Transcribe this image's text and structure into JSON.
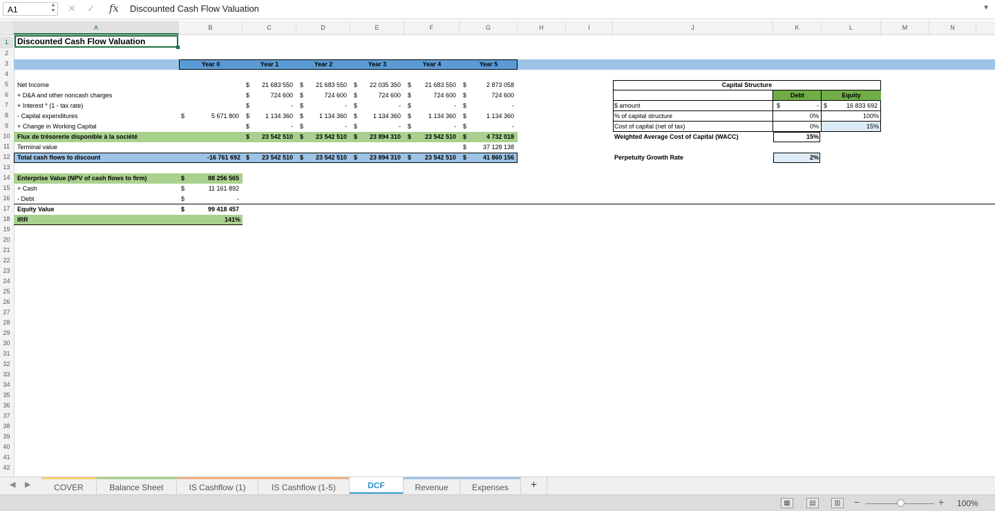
{
  "formula_bar": {
    "cell_ref": "A1",
    "content": "Discounted Cash Flow Valuation",
    "cancel_icon": "close-icon",
    "confirm_icon": "check-icon",
    "fx_label": "fx"
  },
  "columns": [
    "A",
    "B",
    "C",
    "D",
    "E",
    "F",
    "G",
    "H",
    "I",
    "J",
    "K",
    "L",
    "M",
    "N"
  ],
  "rows": [
    "1",
    "2",
    "3",
    "4",
    "5",
    "6",
    "7",
    "8",
    "9",
    "10",
    "11",
    "12",
    "13",
    "14",
    "15",
    "16",
    "17",
    "18",
    "19",
    "20",
    "21",
    "22",
    "23",
    "24",
    "25",
    "26",
    "27",
    "28",
    "29",
    "30",
    "31",
    "32",
    "33",
    "34",
    "35",
    "36",
    "37",
    "38",
    "39",
    "40",
    "41",
    "42"
  ],
  "sheet": {
    "title": "Discounted Cash Flow Valuation",
    "year_headers": [
      "Year 0",
      "Year 1",
      "Year 2",
      "Year 3",
      "Year 4",
      "Year 5"
    ],
    "currency": "$",
    "dcf_rows": [
      {
        "label": "Net Income",
        "y0": "",
        "y1": "21 683 550",
        "y2": "21 683 550",
        "y3": "22 035 350",
        "y4": "21 683 550",
        "y5": "2 873 058"
      },
      {
        "label": "+ D&A and other noncash charges",
        "y0": "",
        "y1": "724 600",
        "y2": "724 600",
        "y3": "724 600",
        "y4": "724 600",
        "y5": "724 600"
      },
      {
        "label": "+ Interest * (1 - tax rate)",
        "y0": "",
        "y1": "-",
        "y2": "-",
        "y3": "-",
        "y4": "-",
        "y5": "-"
      },
      {
        "label": "- Capital expenditures",
        "y0": "5 671 800",
        "y1": "1 134 360",
        "y2": "1 134 360",
        "y3": "1 134 360",
        "y4": "1 134 360",
        "y5": "1 134 360"
      },
      {
        "label": "+ Change in Working Capital",
        "y0": "",
        "y1": "-",
        "y2": "-",
        "y3": "-",
        "y4": "-",
        "y5": "-"
      }
    ],
    "fcf_row": {
      "label": "Flux de trésorerie disponible à la société",
      "y1": "23 542 510",
      "y2": "23 542 510",
      "y3": "23 894 310",
      "y4": "23 542 510",
      "y5": "4 732 018"
    },
    "terminal_row": {
      "label": "Terminal value",
      "y5": "37 128 138"
    },
    "total_row": {
      "label": "Total cash flows to discount",
      "y0": "-16 761 692",
      "y1": "23 542 510",
      "y2": "23 542 510",
      "y3": "23 894 310",
      "y4": "23 542 510",
      "y5": "41 860 156"
    },
    "valuation": [
      {
        "label": "Enterprise Value (NPV of cash flows to firm)",
        "value": "88 256 565"
      },
      {
        "label": "+ Cash",
        "value": "11 161 892"
      },
      {
        "label": "- Debt",
        "value": "-"
      },
      {
        "label": "Equity Value",
        "value": "99 418 457"
      }
    ],
    "irr": {
      "label": "IRR",
      "value": "141%"
    },
    "capital_structure": {
      "title": "Capital Structure",
      "debt_header": "Debt",
      "equity_header": "Equity",
      "amount_label": "$ amount",
      "amount_debt": "-",
      "amount_equity": "16 833 692",
      "pct_label": "% of capital structure",
      "pct_debt": "0%",
      "pct_equity": "100%",
      "cost_label": "Cost of capital (net of tax)",
      "cost_debt": "0%",
      "cost_equity": "15%",
      "wacc_label": "Weighted Average Cost of Capital (WACC)",
      "wacc_value": "15%",
      "growth_label": "Perpetuity Growth Rate",
      "growth_value": "2%"
    }
  },
  "tabs": [
    {
      "label": "COVER",
      "color": "#f3d06b"
    },
    {
      "label": "Balance Sheet",
      "color": "#a9d18e"
    },
    {
      "label": "IS Cashflow (1)",
      "color": "#f4b183"
    },
    {
      "label": "IS Cashflow (1-5)",
      "color": "#f4b183"
    },
    {
      "label": "DCF",
      "color": "#9dc3e6",
      "active": true
    },
    {
      "label": "Revenue",
      "color": "#9dc3e6"
    },
    {
      "label": "Expenses",
      "color": "#9dc3e6"
    }
  ],
  "add_sheet": "+",
  "status": {
    "zoom": "100%",
    "minus": "−",
    "plus": "+"
  },
  "colors": {
    "blue_band": "#9dc3e6",
    "header_blue": "#5b9bd5",
    "green": "#a9d18e",
    "green_header": "#70ad47",
    "light_blue": "#ddebf7"
  }
}
